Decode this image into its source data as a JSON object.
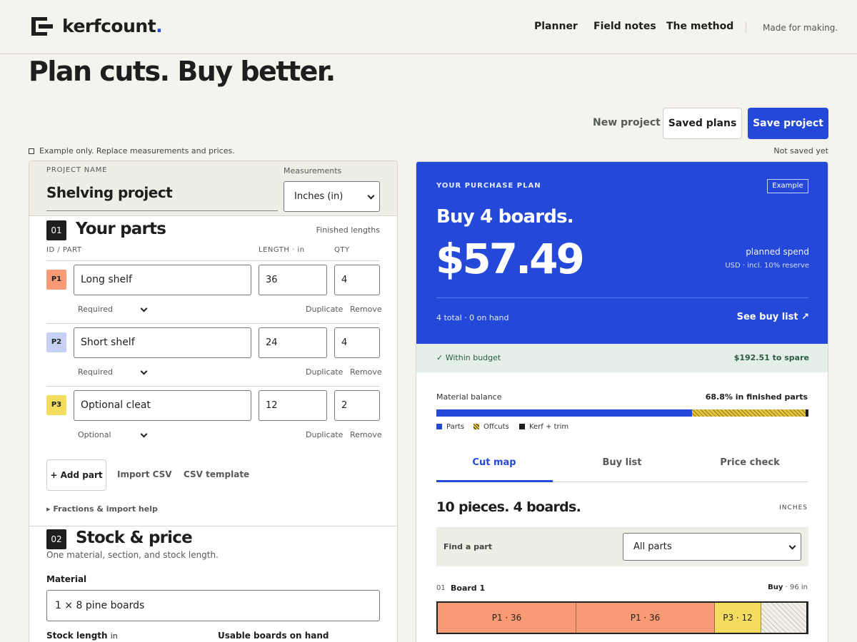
{
  "brand": {
    "name": "kerfcount",
    "dot": ".",
    "accent": "#2448d8"
  },
  "nav": {
    "items": [
      "Planner",
      "Field notes",
      "The method"
    ],
    "tagline": "Made for making."
  },
  "hero": {
    "title": "Plan cuts. Buy better."
  },
  "toolbar": {
    "new_project": "New project",
    "saved_plans": "Saved plans",
    "save_project": "Save project"
  },
  "notice": {
    "text": "Example only. Replace measurements and prices.",
    "save_status": "Not saved yet"
  },
  "project": {
    "name_label": "PROJECT NAME",
    "name_value": "Shelving project",
    "measurements_label": "Measurements",
    "measurements_value": "Inches (in)"
  },
  "parts": {
    "number": "01",
    "title": "Your parts",
    "hint": "Finished lengths",
    "col_id": "ID / PART",
    "col_length": "LENGTH · in",
    "col_qty": "QTY",
    "rows": [
      {
        "id": "P1",
        "name": "Long shelf",
        "length": "36",
        "qty": "4",
        "priority": "Required",
        "color": "#f79a75"
      },
      {
        "id": "P2",
        "name": "Short shelf",
        "length": "24",
        "qty": "4",
        "priority": "Required",
        "color": "#c7d1f4"
      },
      {
        "id": "P3",
        "name": "Optional cleat",
        "length": "12",
        "qty": "2",
        "priority": "Optional",
        "color": "#f4dd5e"
      }
    ],
    "duplicate": "Duplicate",
    "remove": "Remove",
    "add_part": "+ Add part",
    "import_csv": "Import CSV",
    "csv_template": "CSV template",
    "help": "▸ Fractions & import help"
  },
  "stock": {
    "number": "02",
    "title": "Stock & price",
    "hint": "One material, section, and stock length.",
    "material_label": "Material",
    "material_value": "1 × 8 pine boards",
    "stock_length_label": "Stock length",
    "stock_length_unit": "in",
    "usable_label": "Usable boards on hand"
  },
  "plan": {
    "label": "YOUR PURCHASE PLAN",
    "badge": "Example",
    "headline": "Buy 4 boards.",
    "price": "$57.49",
    "spend_label": "planned spend",
    "spend_sub": "USD · incl. 10% reserve",
    "total": "4 total · 0 on hand",
    "see_buy_list": "See buy list ↗",
    "budget_status": "✓  Within budget",
    "budget_spare": "$192.51 to spare"
  },
  "balance": {
    "label": "Material balance",
    "summary": "68.8% in finished parts",
    "parts_fraction": 0.688,
    "offcuts_fraction": 0.305,
    "kerf_fraction": 0.007,
    "legend": [
      "Parts",
      "Offcuts",
      "Kerf + trim"
    ],
    "colors": {
      "parts": "#2448d8",
      "offcuts": "#e6c43c",
      "kerf": "#1c1f1d"
    }
  },
  "tabs": [
    "Cut map",
    "Buy list",
    "Price check"
  ],
  "cutmap": {
    "title": "10 pieces. 4 boards.",
    "unit": "INCHES",
    "find_label": "Find a part",
    "filter_value": "All parts",
    "board": {
      "num": "01",
      "name": "Board 1",
      "buy_label": "Buy",
      "buy_length": "· 96 in",
      "stock_length": 96,
      "pieces": [
        {
          "label": "P1 · 36",
          "length": 36,
          "color": "#f79a75"
        },
        {
          "label": "P1 · 36",
          "length": 36,
          "color": "#f79a75"
        },
        {
          "label": "P3 · 12",
          "length": 12,
          "color": "#f4dd5e"
        }
      ]
    }
  }
}
